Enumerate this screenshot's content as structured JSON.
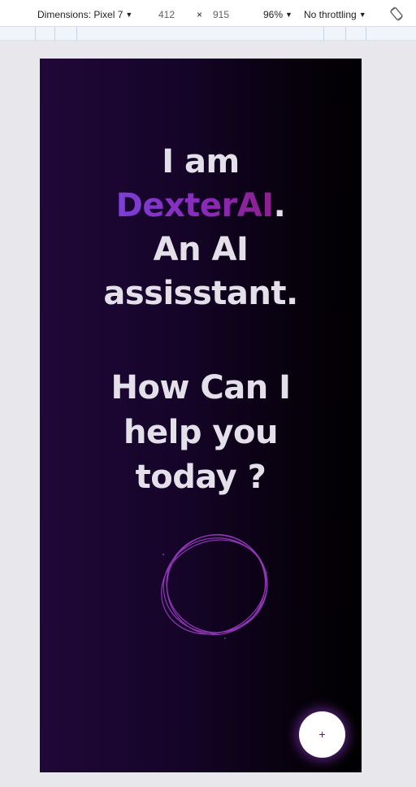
{
  "devtools": {
    "dimensions_label": "Dimensions: Pixel 7",
    "width": "412",
    "times": "×",
    "height": "915",
    "zoom": "96%",
    "throttling": "No throttling"
  },
  "hero": {
    "line1": "I am",
    "brand": "DexterAI",
    "brand_suffix": ".",
    "line3": "An AI",
    "line4": "assisstant."
  },
  "question": {
    "line1": "How Can I",
    "line2": "help you",
    "line3": "today ?"
  },
  "fab": {
    "label": "+"
  },
  "colors": {
    "brand_start": "#7b3fd6",
    "brand_end": "#8e1f8f",
    "scribble": "#a03cc8",
    "background_start": "#200838",
    "background_end": "#000000"
  },
  "icons": {
    "rotate": "rotate-icon",
    "scribble": "scribble-circle-icon"
  }
}
